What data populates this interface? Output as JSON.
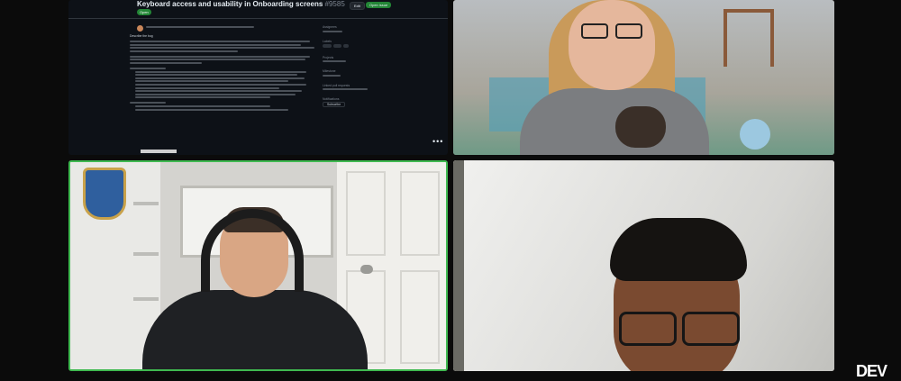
{
  "screen_share": {
    "issue_title": "Keyboard access and usability in Onboarding screens",
    "issue_number": "#9585",
    "header_button_edit": "Edit",
    "header_button_code": "Open issue",
    "status_badge": "Open",
    "comment_body_title": "Describe the bug",
    "side_labels": {
      "assignees": "Assignees",
      "labels": "Labels",
      "projects": "Projects",
      "milestone": "Milestone",
      "linked_pr": "Linked pull requests",
      "notifications": "Notifications"
    },
    "subscribe_label": "Subscribe",
    "more_label": "•••"
  },
  "participants": [
    {
      "tile": "top-right"
    },
    {
      "tile": "bottom-left",
      "active_speaker": true
    },
    {
      "tile": "bottom-right"
    }
  ],
  "brand": {
    "logo_text": "DEV"
  },
  "colors": {
    "active_border": "#3fb950",
    "github_bg": "#0d1117",
    "open_green": "#238636"
  }
}
